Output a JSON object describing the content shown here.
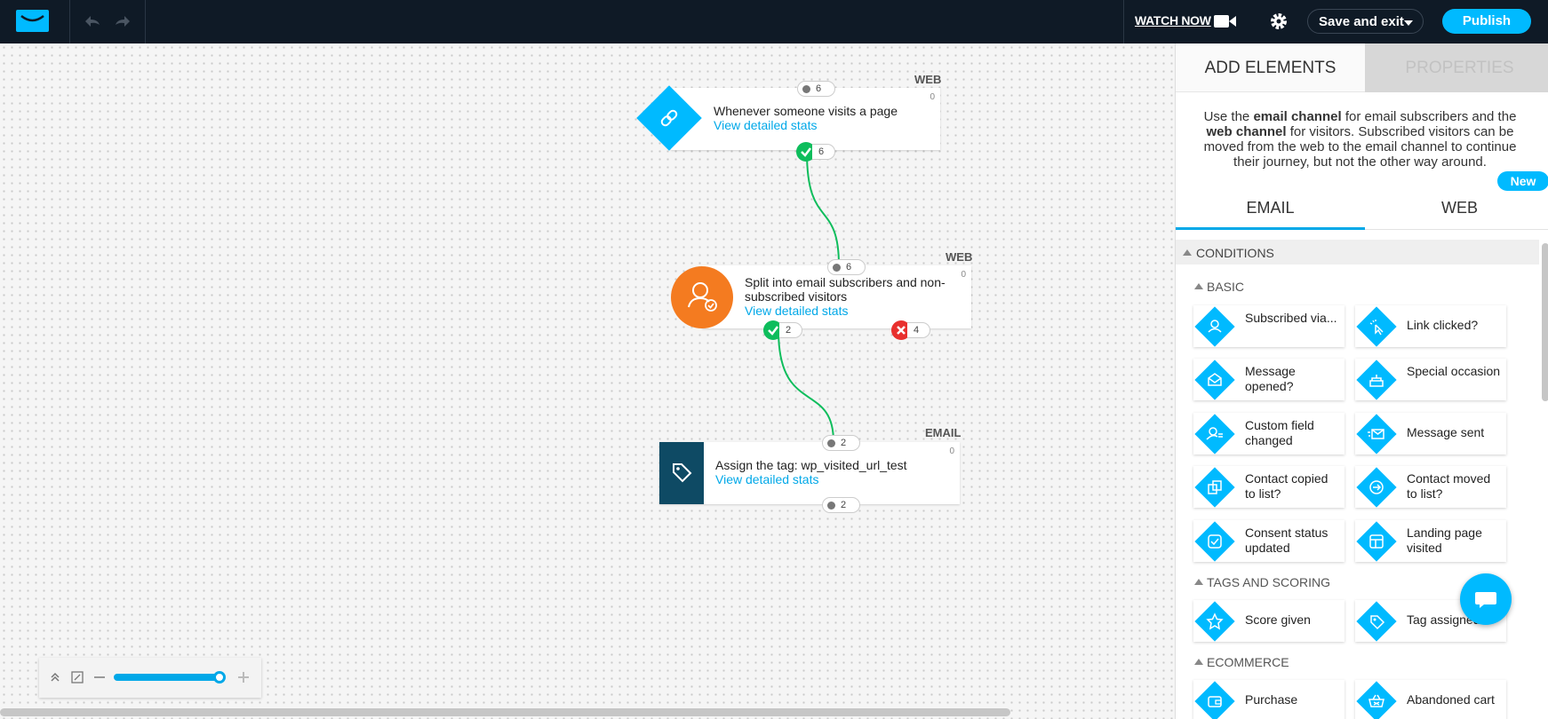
{
  "topbar": {
    "watch_now": "WATCH NOW",
    "save_exit": "Save and exit",
    "publish": "Publish"
  },
  "nodes": [
    {
      "channel": "WEB",
      "count": "0",
      "title": "Whenever someone visits a page",
      "link": "View detailed stats",
      "in": "6",
      "out": "6"
    },
    {
      "channel": "WEB",
      "count": "0",
      "title": "Split into email subscribers and non-subscribed visitors",
      "link": "View detailed stats",
      "in": "6",
      "yes": "2",
      "no": "4"
    },
    {
      "channel": "EMAIL",
      "count": "0",
      "title": "Assign the tag: wp_visited_url_test",
      "link": "View detailed stats",
      "in": "2",
      "out": "2"
    }
  ],
  "panel": {
    "tab_add": "ADD ELEMENTS",
    "tab_properties": "PROPERTIES",
    "info_parts": [
      "Use the ",
      "email channel",
      " for email subscribers and the ",
      "web channel",
      " for visitors. Subscribed visitors can be moved from the web to the email channel to continue their journey, but not the other way around."
    ],
    "new_badge": "New",
    "channel_email": "EMAIL",
    "channel_web": "WEB",
    "section": "CONDITIONS",
    "groups": [
      {
        "name": "BASIC",
        "items": [
          "Subscribed via...",
          "Link clicked?",
          "Message opened?",
          "Special occasion",
          "Custom field changed",
          "Message sent",
          "Contact copied to list?",
          "Contact moved to list?",
          "Consent status updated",
          "Landing page visited"
        ]
      },
      {
        "name": "TAGS AND SCORING",
        "items": [
          "Score given",
          "Tag assigned"
        ]
      },
      {
        "name": "ECOMMERCE",
        "items": [
          "Purchase",
          "Abandoned cart"
        ]
      }
    ]
  },
  "colors": {
    "accent": "#00baff",
    "topbar": "#0f1a26",
    "success": "#0ebd5c",
    "fail": "#e8302e",
    "orange": "#f47b20",
    "tag_node": "#0e4a64"
  }
}
